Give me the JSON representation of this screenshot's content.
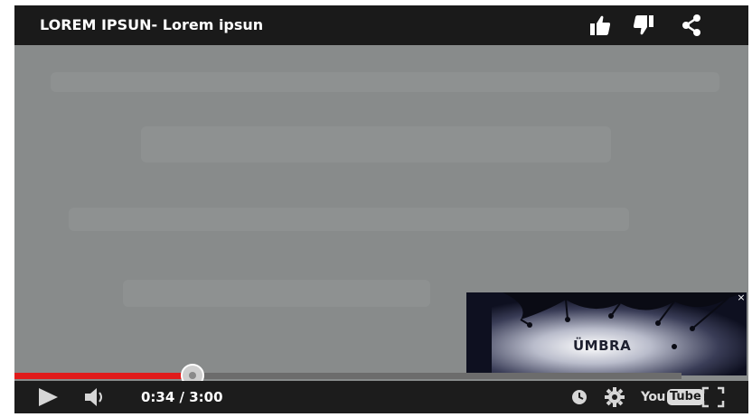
{
  "player": {
    "title": "LOREM IPSUN- Lorem ipsun",
    "icons": {
      "like": "thumbs-up-icon",
      "dislike": "thumbs-down-icon",
      "share": "share-icon"
    },
    "ad": {
      "brand": "ÜMBRA",
      "close_label": "×"
    },
    "progress": {
      "played_fraction": 0.2667,
      "colors": {
        "played": "#e01b1b",
        "track": "#6c6c6c"
      }
    },
    "controls": {
      "time_display": "0:34 / 3:00",
      "logo_you": "You",
      "logo_tube": "Tube",
      "icons": {
        "play": "play-icon",
        "volume": "volume-icon",
        "watch_later": "clock-icon",
        "settings": "gear-icon",
        "fullscreen": "fullscreen-icon"
      }
    }
  }
}
